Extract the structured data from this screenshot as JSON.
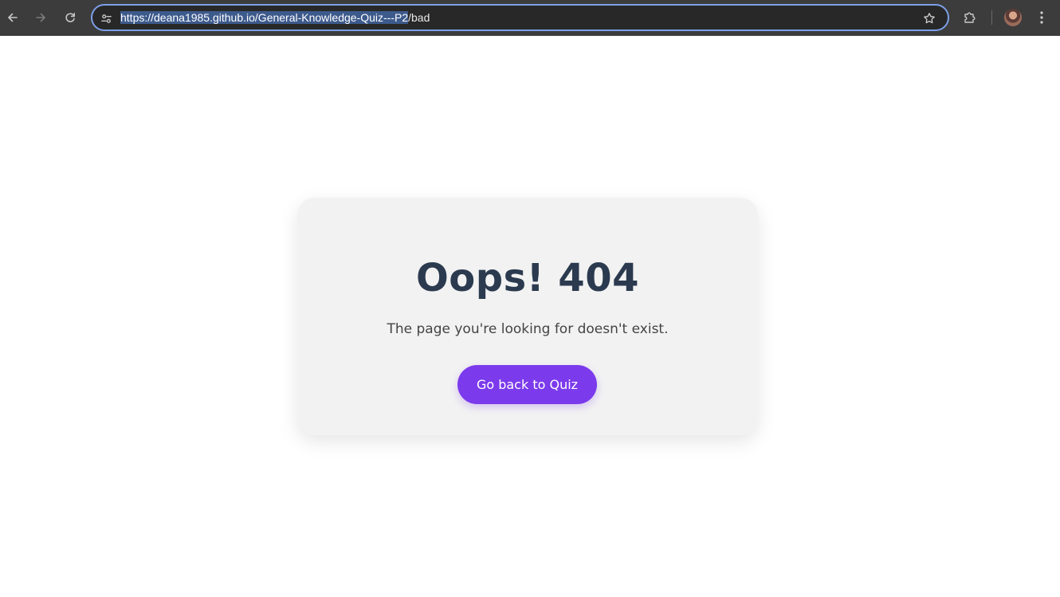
{
  "browser": {
    "url_selected": "https://deana1985.github.io/General-Knowledge-Quiz---P2",
    "url_rest": "/bad",
    "icons": {
      "back": "arrow-left-icon",
      "forward": "arrow-right-icon",
      "reload": "reload-icon",
      "site_info": "tune-icon",
      "bookmark": "star-icon",
      "extensions": "puzzle-icon",
      "menu": "kebab-menu-icon"
    }
  },
  "page": {
    "title": "Oops! 404",
    "message": "The page you're looking for doesn't exist.",
    "button_label": "Go back to Quiz"
  },
  "colors": {
    "title": "#2b3a4f",
    "button": "#7b3aec",
    "card": "#f2f2f2",
    "omnibox_focus": "#7ca0e8"
  }
}
